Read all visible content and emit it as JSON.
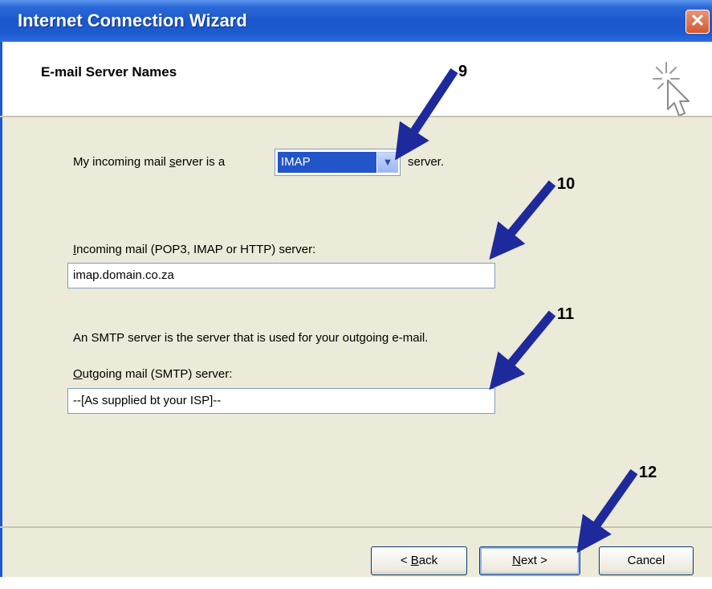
{
  "window": {
    "title": "Internet Connection Wizard",
    "close_label": "✕"
  },
  "header": {
    "title": "E-mail Server Names",
    "icon": "wizard-sparkle-cursor-icon"
  },
  "form": {
    "incoming_type_prefix": "My incoming mail ",
    "incoming_type_accel": "s",
    "incoming_type_rest": "erver is a",
    "incoming_type_value": "IMAP",
    "incoming_type_suffix": "server.",
    "incoming_label_accel": "I",
    "incoming_label_rest": "ncoming mail (POP3, IMAP or HTTP) server:",
    "incoming_value": "imap.domain.co.za",
    "smtp_info": "An SMTP server is the server that is used for your outgoing e-mail.",
    "outgoing_label_accel": "O",
    "outgoing_label_rest": "utgoing mail (SMTP) server:",
    "outgoing_value": "--[As supplied bt your ISP]--"
  },
  "buttons": {
    "back_prefix": "< ",
    "back_accel": "B",
    "back_rest": "ack",
    "next_accel": "N",
    "next_rest": "ext >",
    "cancel": "Cancel"
  },
  "annotations": {
    "a9": "9",
    "a10": "10",
    "a11": "11",
    "a12": "12",
    "arrow_color": "#1e2a9c"
  }
}
